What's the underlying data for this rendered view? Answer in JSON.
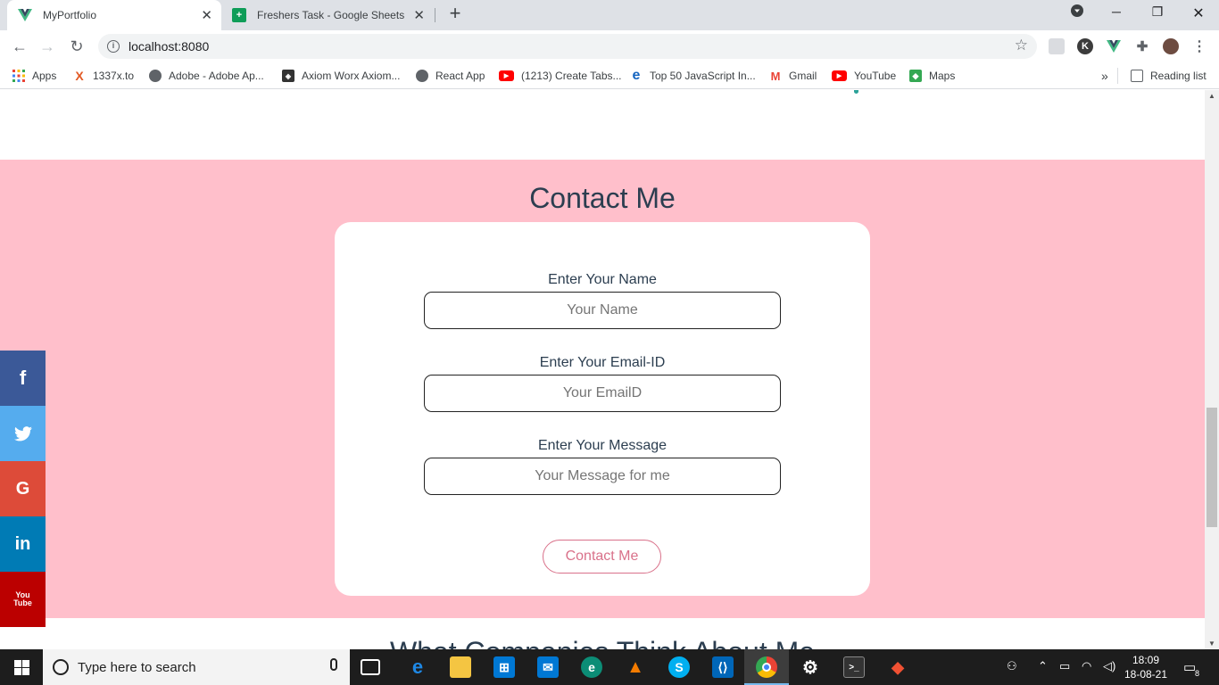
{
  "browser": {
    "tabs": [
      {
        "title": "MyPortfolio",
        "active": true
      },
      {
        "title": "Freshers Task - Google Sheets",
        "active": false
      }
    ],
    "url": "localhost:8080",
    "bookmarks": [
      {
        "label": "Apps",
        "icon": "apps-grid-icon",
        "color": "#ea4335"
      },
      {
        "label": "1337x.to",
        "icon": "x-icon",
        "color": "#e25822"
      },
      {
        "label": "Adobe - Adobe Ap...",
        "icon": "globe-icon",
        "color": "#5f6368"
      },
      {
        "label": "Axiom Worx Axiom...",
        "icon": "axiom-icon",
        "color": "#444"
      },
      {
        "label": "React App",
        "icon": "globe-icon",
        "color": "#5f6368"
      },
      {
        "label": "(1213) Create Tabs...",
        "icon": "youtube-icon",
        "color": "#ff0000"
      },
      {
        "label": "Top 50 JavaScript In...",
        "icon": "e-icon",
        "color": "#1565c0"
      },
      {
        "label": "Gmail",
        "icon": "gmail-icon",
        "color": "#ea4335"
      },
      {
        "label": "YouTube",
        "icon": "youtube-icon",
        "color": "#ff0000"
      },
      {
        "label": "Maps",
        "icon": "maps-icon",
        "color": "#34a853"
      }
    ],
    "reading_list": "Reading list"
  },
  "page": {
    "contact_title": "Contact Me",
    "form": {
      "name_label": "Enter Your Name",
      "name_placeholder": "Your Name",
      "email_label": "Enter Your Email-ID",
      "email_placeholder": "Your EmailD",
      "message_label": "Enter Your Message",
      "message_placeholder": "Your Message for me",
      "submit_label": "Contact Me"
    },
    "next_section_title": "What Companies Think About Me",
    "colors": {
      "section_bg": "#ffbfcb",
      "button_accent": "#d9718a",
      "text": "#2c3e50"
    }
  },
  "social": [
    {
      "name": "facebook",
      "glyph": "f",
      "color": "#3b5998"
    },
    {
      "name": "twitter",
      "glyph": "t",
      "color": "#55acee"
    },
    {
      "name": "google",
      "glyph": "G",
      "color": "#dd4b39"
    },
    {
      "name": "linkedin",
      "glyph": "in",
      "color": "#007bb5"
    },
    {
      "name": "youtube",
      "glyph": "You Tube",
      "color": "#bb0000"
    }
  ],
  "taskbar": {
    "search_placeholder": "Type here to search",
    "time": "18:09",
    "date": "18-08-21",
    "notification_count": "8"
  }
}
